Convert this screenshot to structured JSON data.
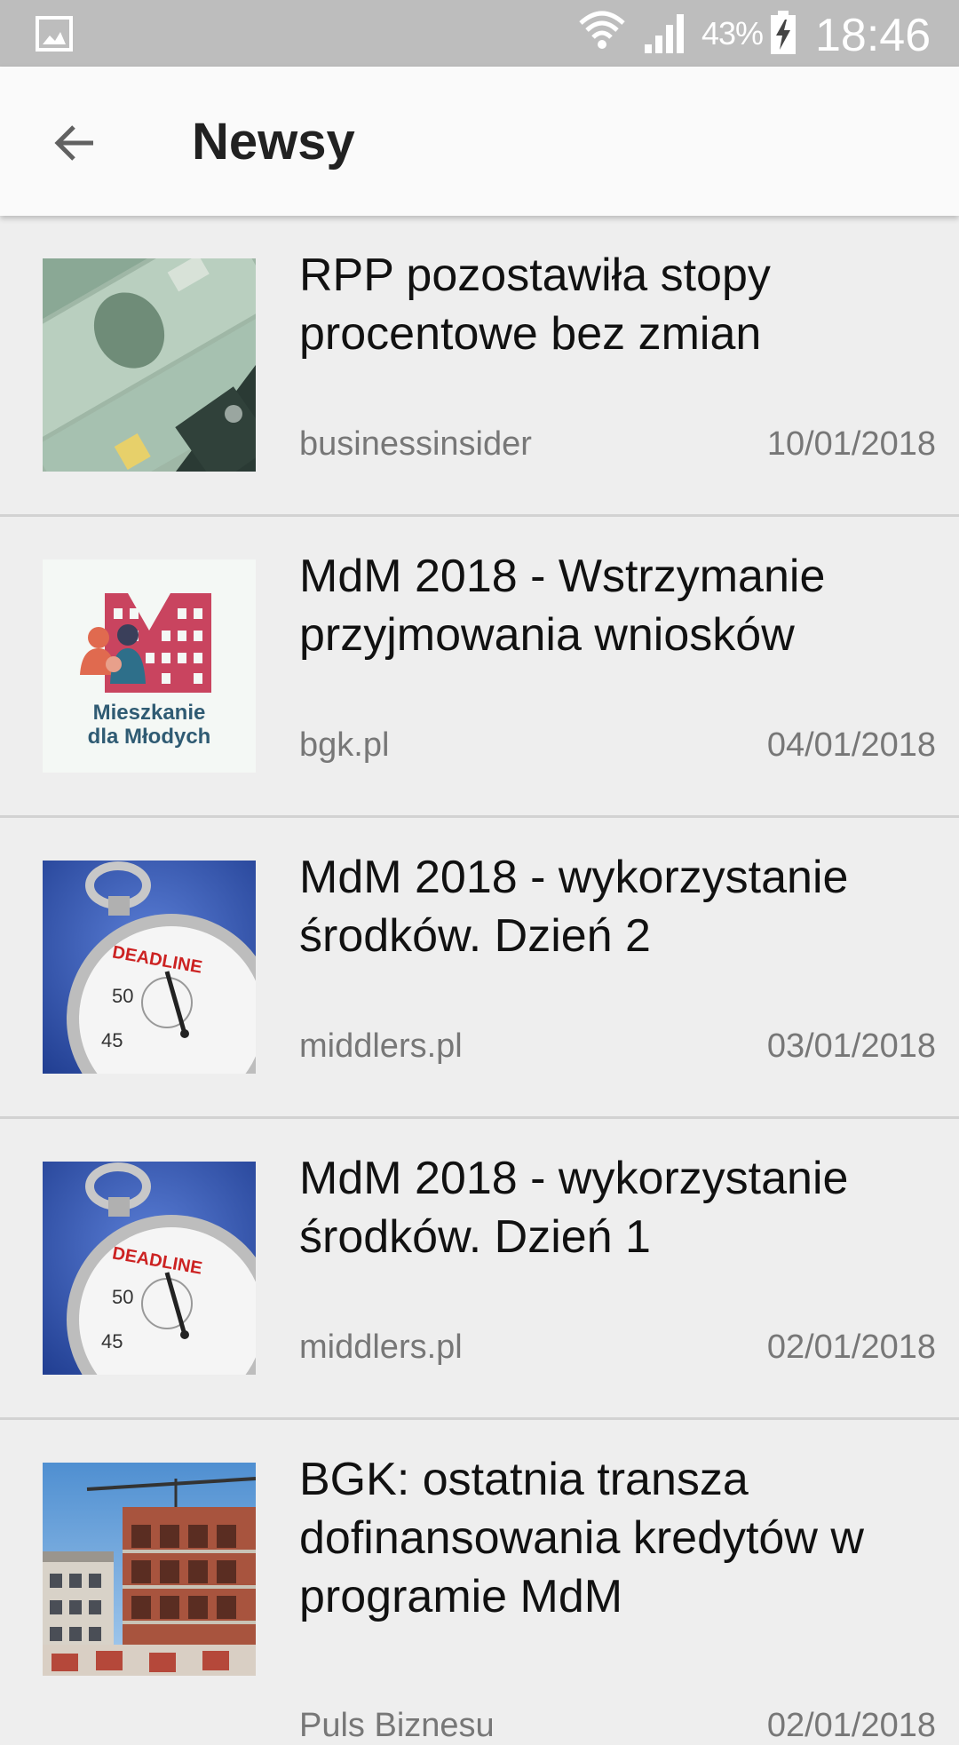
{
  "status_bar": {
    "battery": "43%",
    "time": "18:46"
  },
  "app_bar": {
    "title": "Newsy"
  },
  "news": [
    {
      "title": "RPP pozostawiła stopy procentowe bez zmian",
      "source": "businessinsider",
      "date": "10/01/2018",
      "thumb": "banknotes"
    },
    {
      "title": "MdM 2018 - Wstrzymanie przyjmowania wniosków",
      "source": "bgk.pl",
      "date": "04/01/2018",
      "thumb": "mdm-logo",
      "thumb_text": [
        "Mieszkanie",
        "dla Młodych"
      ]
    },
    {
      "title": "MdM 2018 - wykorzystanie środków. Dzień 2",
      "source": "middlers.pl",
      "date": "03/01/2018",
      "thumb": "stopwatch",
      "thumb_text": [
        "DEADLINE",
        "50",
        "45"
      ]
    },
    {
      "title": "MdM 2018 - wykorzystanie środków. Dzień 1",
      "source": "middlers.pl",
      "date": "02/01/2018",
      "thumb": "stopwatch",
      "thumb_text": [
        "DEADLINE",
        "50",
        "45"
      ]
    },
    {
      "title": "BGK: ostatnia transza dofinansowania kredytów w programie MdM",
      "source": "Puls Biznesu",
      "date": "02/01/2018",
      "thumb": "construction"
    }
  ]
}
